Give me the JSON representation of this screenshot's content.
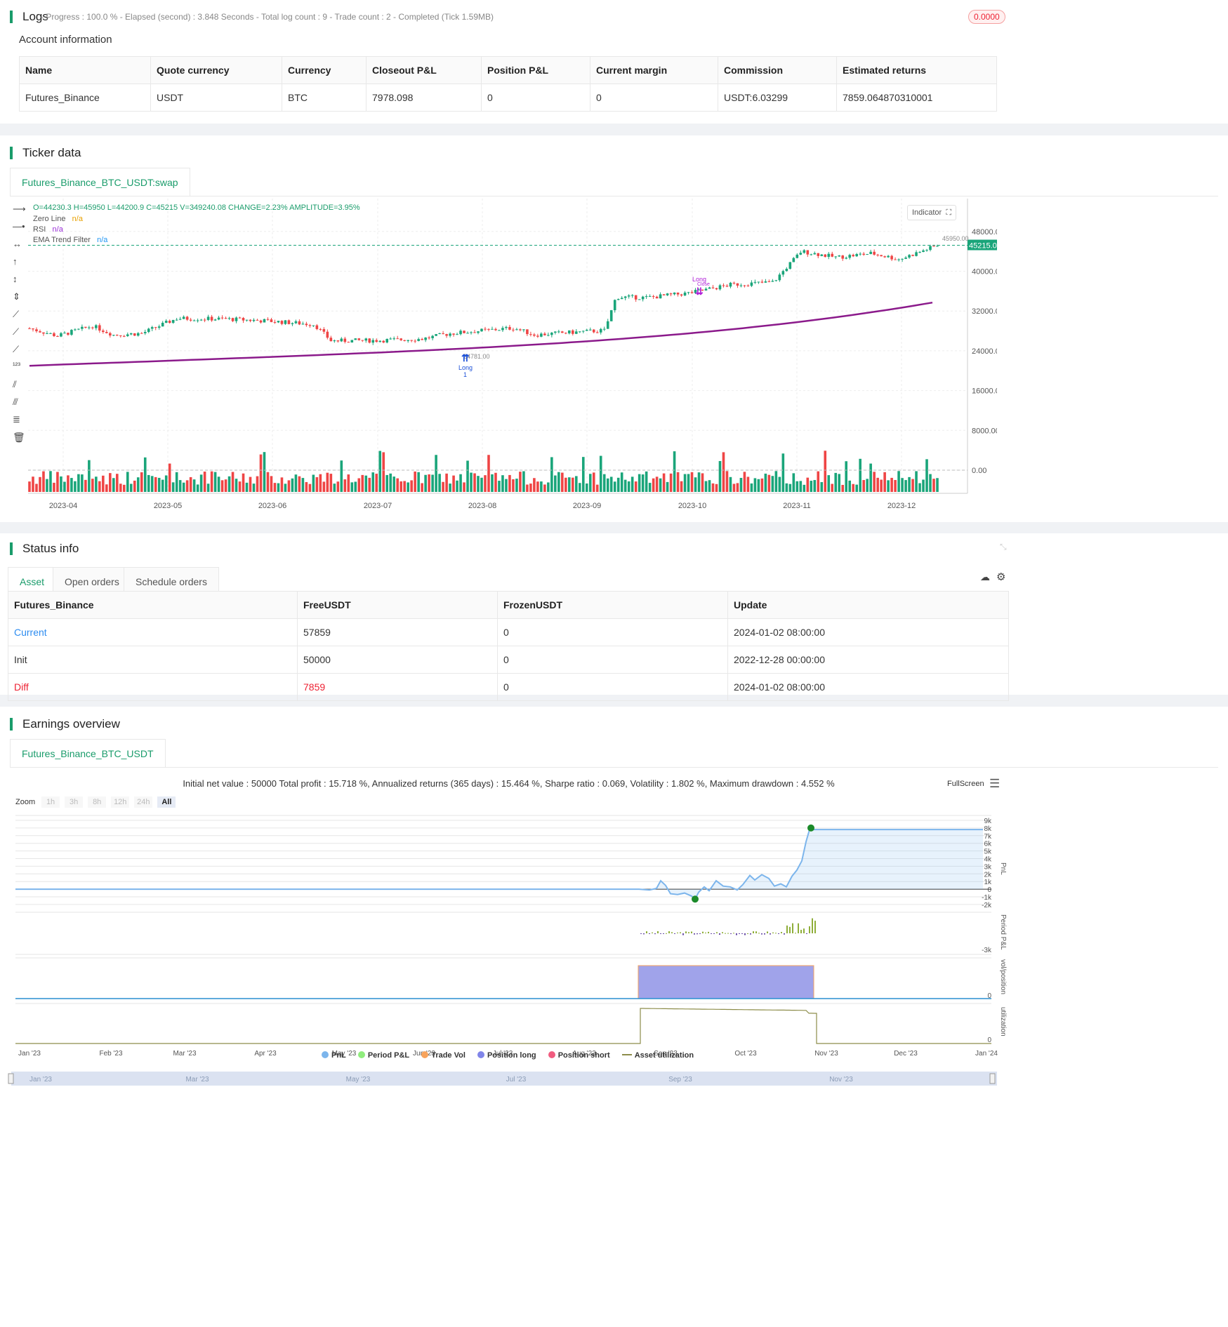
{
  "logs": {
    "title": "Logs",
    "progress_text": "- Progress : 100.0 % - Elapsed (second) : 3.848  Seconds - Total log count : 9 - Trade count : 2 - Completed (Tick 1.59MB)",
    "badge": "0.0000",
    "account_title": "Account information",
    "columns": [
      "Name",
      "Quote currency",
      "Currency",
      "Closeout P&L",
      "Position P&L",
      "Current margin",
      "Commission",
      "Estimated returns"
    ],
    "row": [
      "Futures_Binance",
      "USDT",
      "BTC",
      "7978.098",
      "0",
      "0",
      "USDT:6.03299",
      "7859.064870310001"
    ]
  },
  "ticker": {
    "title": "Ticker data",
    "tab": "Futures_Binance_BTC_USDT:swap",
    "ohlc": "O=44230.3 H=45950 L=44200.9 C=45215 V=349240.08 CHANGE=2.23% AMPLITUDE=3.95%",
    "legend": [
      {
        "name": "Zero Line",
        "value": "n/a",
        "color": "#e8a000"
      },
      {
        "name": "RSI",
        "value": "n/a",
        "color": "#9b30d8"
      },
      {
        "name": "EMA Trend Filter",
        "value": "n/a",
        "color": "#2196f3"
      }
    ],
    "indicator_button": "Indicator",
    "y_ticks": [
      "48000.00",
      "40000.00",
      "32000.00",
      "24000.00",
      "16000.00",
      "8000.00",
      "0.00"
    ],
    "last_price": "45215.00",
    "high_label": "45950.00",
    "low_label": "24781.00",
    "x_ticks": [
      "2023-04",
      "2023-05",
      "2023-06",
      "2023-07",
      "2023-08",
      "2023-09",
      "2023-10",
      "2023-11",
      "2023-12"
    ],
    "markers": {
      "long_label": "Long",
      "long_count": "1",
      "close_label": "Long",
      "close_sub": "Close"
    }
  },
  "status": {
    "title": "Status info",
    "tabs": [
      "Asset",
      "Open orders",
      "Schedule orders"
    ],
    "columns": [
      "Futures_Binance",
      "FreeUSDT",
      "FrozenUSDT",
      "Update"
    ],
    "rows": [
      {
        "label": "Current",
        "free": "57859",
        "frozen": "0",
        "update": "2024-01-02 08:00:00"
      },
      {
        "label": "Init",
        "free": "50000",
        "frozen": "0",
        "update": "2022-12-28 00:00:00"
      },
      {
        "label": "Diff",
        "free": "7859",
        "frozen": "0",
        "update": "2024-01-02 08:00:00"
      }
    ]
  },
  "earnings": {
    "title": "Earnings overview",
    "tab": "Futures_Binance_BTC_USDT",
    "summary": "Initial net value : 50000 Total profit : 15.718 %, Annualized returns (365 days) : 15.464 %, Sharpe ratio : 0.069, Volatility : 1.802 %, Maximum drawdown : 4.552 %",
    "fullscreen": "FullScreen",
    "zoom_label": "Zoom",
    "zoom_options": [
      "1h",
      "3h",
      "8h",
      "12h",
      "24h",
      "All"
    ],
    "pnl_ticks": [
      "9k",
      "8k",
      "7k",
      "6k",
      "5k",
      "4k",
      "3k",
      "2k",
      "1k",
      "0",
      "-1k",
      "-2k"
    ],
    "pnl_axis": "PnL",
    "period_axis": "Period P&L",
    "period_tick": "-3k",
    "vol_axis": "vol/position",
    "vol_tick": "0",
    "util_axis": "utilization",
    "util_tick": "0",
    "x_ticks": [
      "Jan '23",
      "Feb '23",
      "Mar '23",
      "Apr '23",
      "May '23",
      "Jun '23",
      "Jul '23",
      "Aug '23",
      "Sep '23",
      "Oct '23",
      "Nov '23",
      "Dec '23",
      "Jan '24"
    ],
    "nav_ticks": [
      "Jan '23",
      "Mar '23",
      "May '23",
      "Jul '23",
      "Sep '23",
      "Nov '23"
    ],
    "legend": [
      {
        "name": "PnL",
        "color": "#7cb5ec"
      },
      {
        "name": "Period P&L",
        "color": "#90ed7d"
      },
      {
        "name": "Trade Vol",
        "color": "#f7a35c"
      },
      {
        "name": "Position long",
        "color": "#8085e9"
      },
      {
        "name": "Position short",
        "color": "#f15c80"
      },
      {
        "name": "Asset utilization",
        "color": "#8d8d4a"
      }
    ]
  }
}
